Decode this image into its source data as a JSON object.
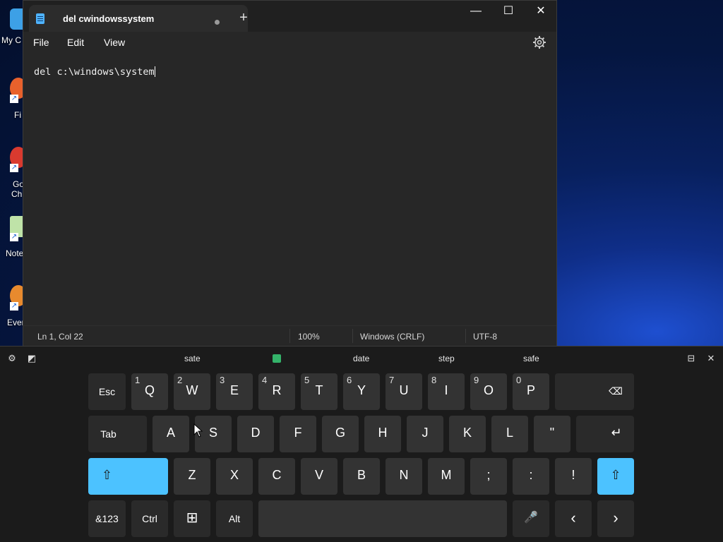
{
  "desktop": {
    "icons": [
      {
        "label": "My C"
      },
      {
        "label": "Fi"
      },
      {
        "label": "Go",
        "label2": "Ch"
      },
      {
        "label": "Note"
      },
      {
        "label": "Ever"
      }
    ]
  },
  "notepad": {
    "tab_title": "del cwindowssystem",
    "new_tab_symbol": "+",
    "window_controls": {
      "minimize": "—",
      "maximize": "☐",
      "close": "✕"
    },
    "menu": [
      "File",
      "Edit",
      "View"
    ],
    "settings_icon": "gear-icon",
    "content": "del c:\\windows\\system",
    "status": {
      "position": "Ln 1, Col 22",
      "zoom": "100%",
      "line_ending": "Windows (CRLF)",
      "encoding": "UTF-8"
    }
  },
  "keyboard": {
    "suggestions": [
      "sate",
      "date",
      "step",
      "safe"
    ],
    "row1": [
      {
        "label": "Esc"
      },
      {
        "label": "Q",
        "sub": "1"
      },
      {
        "label": "W",
        "sub": "2"
      },
      {
        "label": "E",
        "sub": "3"
      },
      {
        "label": "R",
        "sub": "4"
      },
      {
        "label": "T",
        "sub": "5"
      },
      {
        "label": "Y",
        "sub": "6"
      },
      {
        "label": "U",
        "sub": "7"
      },
      {
        "label": "I",
        "sub": "8"
      },
      {
        "label": "O",
        "sub": "9"
      },
      {
        "label": "P",
        "sub": "0"
      },
      {
        "label": "⌫"
      }
    ],
    "row2": [
      {
        "label": "Tab"
      },
      {
        "label": "A"
      },
      {
        "label": "S"
      },
      {
        "label": "D"
      },
      {
        "label": "F"
      },
      {
        "label": "G"
      },
      {
        "label": "H"
      },
      {
        "label": "J"
      },
      {
        "label": "K"
      },
      {
        "label": "L"
      },
      {
        "label": "\""
      },
      {
        "label": "↵"
      }
    ],
    "row3": [
      {
        "label": "⇧"
      },
      {
        "label": "Z"
      },
      {
        "label": "X"
      },
      {
        "label": "C"
      },
      {
        "label": "V"
      },
      {
        "label": "B"
      },
      {
        "label": "N"
      },
      {
        "label": "M"
      },
      {
        "label": ";"
      },
      {
        "label": ":"
      },
      {
        "label": "!"
      },
      {
        "label": "⇧"
      }
    ],
    "row4": [
      {
        "label": "&123"
      },
      {
        "label": "Ctrl"
      },
      {
        "label": "⊞"
      },
      {
        "label": "Alt"
      },
      {
        "label": ""
      },
      {
        "label": "🎤"
      },
      {
        "label": "‹"
      },
      {
        "label": "›"
      }
    ],
    "colors": {
      "shift_active": "#4cc2ff",
      "key": "#333333"
    }
  }
}
